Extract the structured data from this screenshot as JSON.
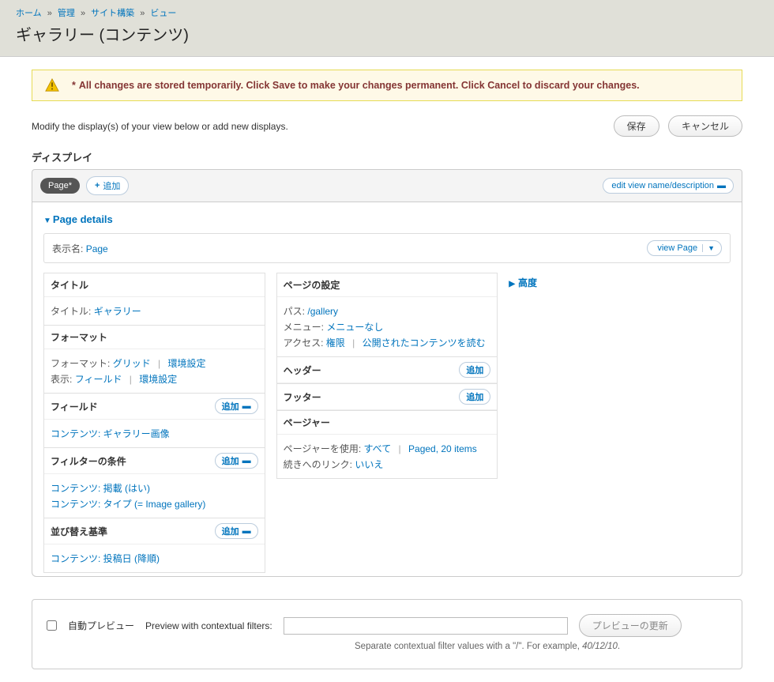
{
  "breadcrumbs": {
    "home": "ホーム",
    "admin": "管理",
    "structure": "サイト構築",
    "views": "ビュー"
  },
  "page_title": "ギャラリー (コンテンツ)",
  "warning": "All changes are stored temporarily. Click Save to make your changes permanent. Click Cancel to discard your changes.",
  "help": "Modify the display(s) of your view below or add new displays.",
  "buttons": {
    "save": "保存",
    "cancel": "キャンセル",
    "add": "追加",
    "add_display": "追加",
    "edit_name": "edit view name/description",
    "view_page": "view Page",
    "update_preview": "プレビューの更新"
  },
  "displays_heading": "ディスプレイ",
  "tab_page": "Page*",
  "details_head": "Page details",
  "display_name": {
    "label": "表示名:",
    "value": "Page"
  },
  "col1": {
    "title": {
      "head": "タイトル",
      "label": "タイトル:",
      "value": "ギャラリー"
    },
    "format": {
      "head": "フォーマット",
      "label": "フォーマット:",
      "value": "グリッド",
      "settings": "環境設定",
      "show_label": "表示:",
      "show_value": "フィールド",
      "show_settings": "環境設定"
    },
    "fields": {
      "head": "フィールド",
      "item": "コンテンツ: ギャラリー画像"
    },
    "filters": {
      "head": "フィルターの条件",
      "item1": "コンテンツ: 掲載 (はい)",
      "item2": "コンテンツ: タイプ (= Image gallery)"
    },
    "sort": {
      "head": "並び替え基準",
      "item": "コンテンツ: 投稿日 (降順)"
    }
  },
  "col2": {
    "pagesettings": {
      "head": "ページの設定",
      "path_label": "パス:",
      "path_value": "/gallery",
      "menu_label": "メニュー:",
      "menu_value": "メニューなし",
      "access_label": "アクセス:",
      "access_value": "権限",
      "access_extra": "公開されたコンテンツを読む"
    },
    "header": {
      "head": "ヘッダー"
    },
    "footer": {
      "head": "フッター"
    },
    "pager": {
      "head": "ページャー",
      "use_label": "ページャーを使用:",
      "use_value": "すべて",
      "use_extra": "Paged, 20 items",
      "more_label": "続きへのリンク:",
      "more_value": "いいえ"
    }
  },
  "advanced": "高度",
  "preview": {
    "auto": "自動プレビュー",
    "label": "Preview with contextual filters:",
    "help_pre": "Separate contextual filter values with a \"/\". For example, ",
    "help_ex": "40/12/10",
    "help_post": "."
  }
}
